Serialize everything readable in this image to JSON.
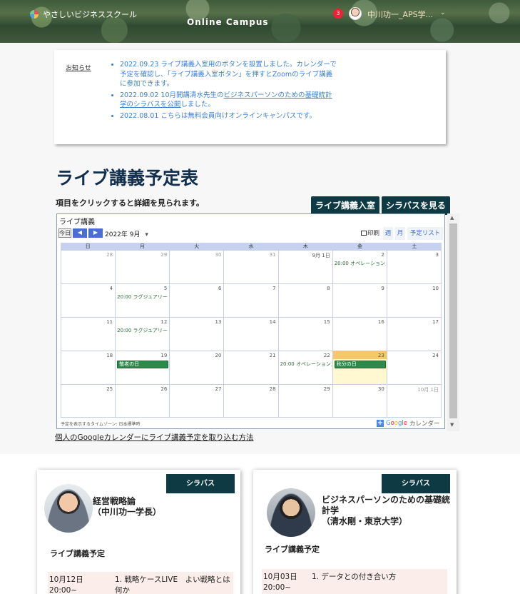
{
  "header": {
    "logo_text": "やさしいビジネススクール",
    "campus_title": "Online Campus",
    "notification_count": "3",
    "username": "中川功一_APS学...",
    "caret": "⌄"
  },
  "notice": {
    "label": "お知らせ",
    "items": [
      {
        "text": "2022.09.23 ライブ講義入室用のボタンを設置しました。カレンダーで予定を確認し、「ライブ講義入室ボタン」を押すとZoomのライブ講義に参加できます。"
      },
      {
        "pre": "2022.09.02 10月開講清水先生の",
        "link": "ビジネスパーソンのための基礎統計学のシラバスを公開",
        "post": "しました。"
      },
      {
        "text": "2022.08.01 こちらは無料会員向けオンラインキャンパスです。"
      }
    ]
  },
  "page": {
    "title": "ライブ講義予定表",
    "subtitle": "項目をクリックすると詳細を見られます。",
    "enter_button": "ライブ講義入室",
    "syllabus_button": "シラバスを見る",
    "gcal_link": "個人のGoogleカレンダーにライブ講義予定を取り込む方法"
  },
  "calendar": {
    "title": "ライブ講義",
    "today_btn": "今日",
    "prev_btn": "◀",
    "next_btn": "▶",
    "month": "2022年 9月",
    "month_caret": "▾",
    "print": "印刷",
    "view_week": "週",
    "view_month": "月",
    "view_agenda": "予定リスト",
    "dow": [
      "日",
      "月",
      "火",
      "水",
      "木",
      "金",
      "土"
    ],
    "weeks": [
      [
        {
          "d": "28",
          "o": true
        },
        {
          "d": "29",
          "o": true
        },
        {
          "d": "30",
          "o": true
        },
        {
          "d": "31",
          "o": true
        },
        {
          "d": "9月 1日"
        },
        {
          "d": "2",
          "ev": "20:00 オペレーションズ"
        },
        {
          "d": "3"
        }
      ],
      [
        {
          "d": "4"
        },
        {
          "d": "5",
          "ev": "20:00 ラグジュアリー・"
        },
        {
          "d": "6"
        },
        {
          "d": "7"
        },
        {
          "d": "8"
        },
        {
          "d": "9"
        },
        {
          "d": "10"
        }
      ],
      [
        {
          "d": "11"
        },
        {
          "d": "12",
          "ev": "20:00 ラグジュアリー・"
        },
        {
          "d": "13"
        },
        {
          "d": "14"
        },
        {
          "d": "15"
        },
        {
          "d": "16"
        },
        {
          "d": "17"
        }
      ],
      [
        {
          "d": "18"
        },
        {
          "d": "19",
          "block": "敬老の日"
        },
        {
          "d": "20"
        },
        {
          "d": "21"
        },
        {
          "d": "22",
          "ev": "20:00 オペレーションズ"
        },
        {
          "d": "23",
          "block": "秋分の日",
          "today": true
        },
        {
          "d": "24"
        }
      ],
      [
        {
          "d": "25"
        },
        {
          "d": "26"
        },
        {
          "d": "27"
        },
        {
          "d": "28"
        },
        {
          "d": "29"
        },
        {
          "d": "30"
        },
        {
          "d": "10月 1日",
          "o": true
        }
      ]
    ],
    "footer": "予定を表示するタイムゾーン: 日本標準時",
    "gcal_suffix": "カレンダー"
  },
  "courses": [
    {
      "syllabus": "シラバス",
      "name": "経営戦略論\n（中川功一学長）",
      "live": "ライブ講義予定",
      "date": "10月12日\n20:00~",
      "topic": "1. 戦略ケースLIVE　よい戦略とは何か"
    },
    {
      "syllabus": "シラバス",
      "name": "ビジネスパーソンのための基礎統計学\n（清水剛・東京大学）",
      "live": "ライブ講義予定",
      "date": "10月03日\n20:00~",
      "topic": "1. データとの付き合い方"
    }
  ]
}
